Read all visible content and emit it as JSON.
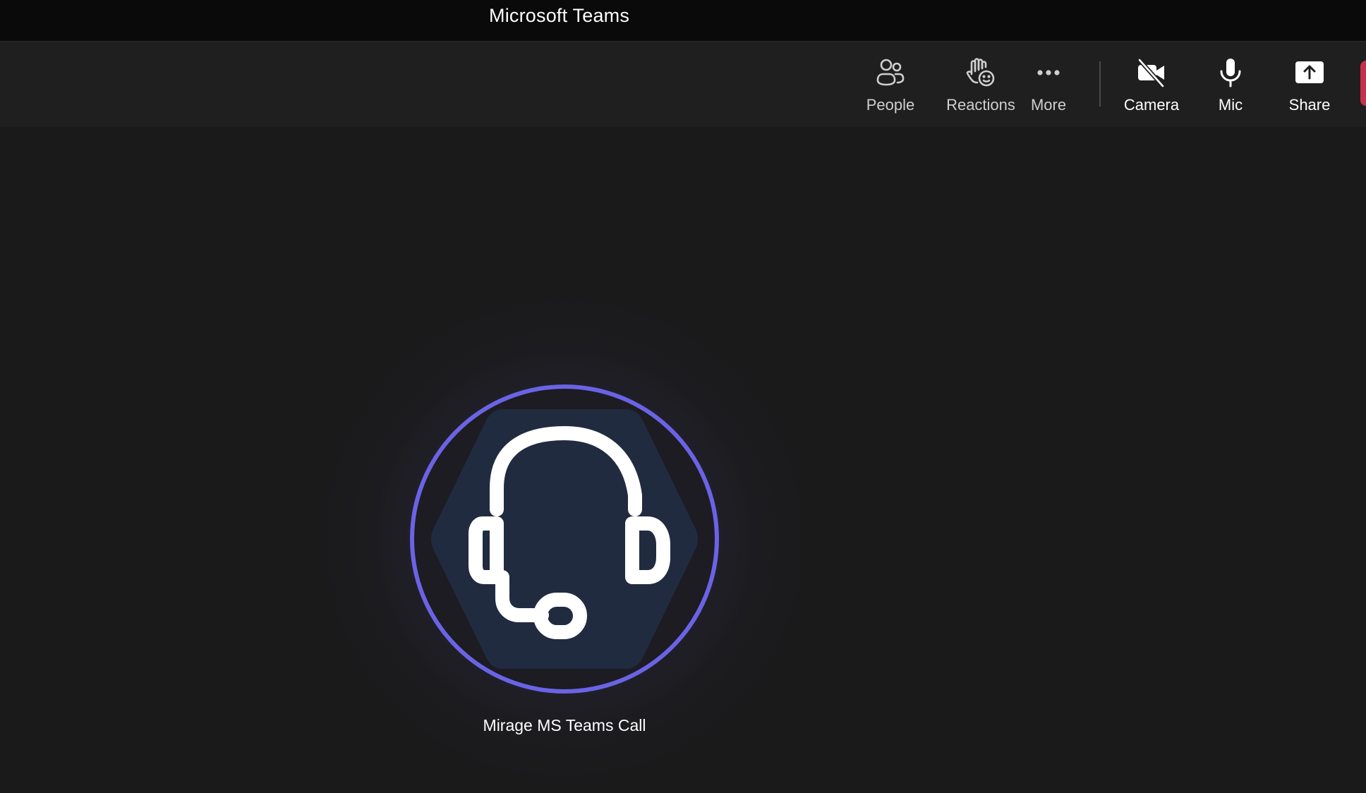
{
  "window": {
    "title": "Microsoft Teams"
  },
  "toolbar": {
    "people": {
      "label": "People",
      "icon": "people-icon"
    },
    "reactions": {
      "label": "Reactions",
      "icon": "raise-hand-emoji-icon"
    },
    "more": {
      "label": "More",
      "icon": "more-dots-icon"
    },
    "camera": {
      "label": "Camera",
      "icon": "camera-off-icon",
      "state": "off"
    },
    "mic": {
      "label": "Mic",
      "icon": "microphone-icon",
      "state": "on"
    },
    "share": {
      "label": "Share",
      "icon": "share-screen-icon"
    }
  },
  "participant": {
    "name": "Mirage MS Teams Call",
    "avatar_icon": "headset-icon",
    "ring_color": "#6b63e6",
    "hex_color": "#212b40"
  },
  "colors": {
    "titlebar": "#0a0a0a",
    "toolbar": "#1f1f1f",
    "stage": "#1a1a1a",
    "leave_accent": "#c4314b"
  }
}
